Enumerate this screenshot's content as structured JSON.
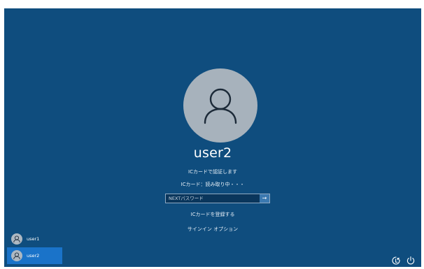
{
  "user": {
    "name": "user2"
  },
  "messages": {
    "auth_prompt": "ICカードで認証します",
    "card_status": "ICカード：読み取り中・・・"
  },
  "password": {
    "placeholder": "NEXTパスワード",
    "submit_icon": "arrow-right-icon"
  },
  "links": {
    "register_card": "ICカードを登録する",
    "sign_in_options": "サインイン オプション"
  },
  "user_list": [
    {
      "name": "user1",
      "selected": false
    },
    {
      "name": "user2",
      "selected": true
    }
  ],
  "system_icons": [
    "accessibility-icon",
    "power-icon"
  ],
  "colors": {
    "background": "#0f4d7e",
    "selected_user": "#1a73c9",
    "avatar": "#a7b2bc"
  }
}
